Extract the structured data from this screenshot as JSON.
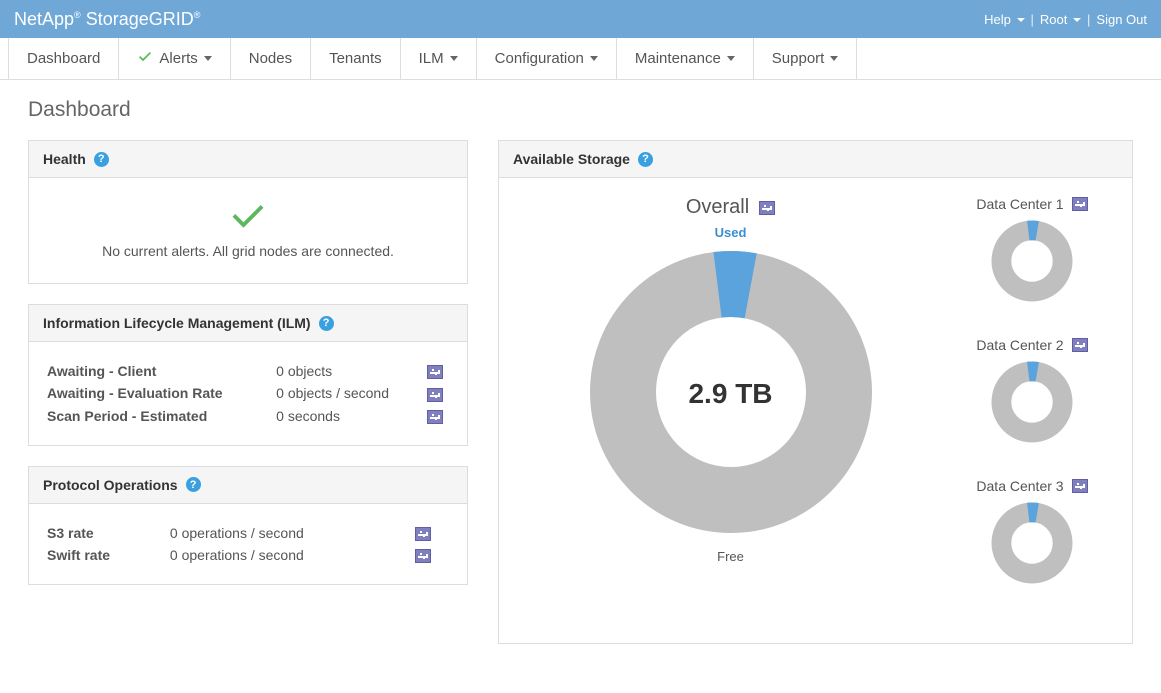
{
  "brand": {
    "text": "NetApp® StorageGRID®",
    "plain1": "NetApp",
    "reg": "®",
    "plain2": " StorageGRID",
    "reg2": "®"
  },
  "topRight": {
    "help": "Help",
    "user": "Root",
    "signOut": "Sign Out"
  },
  "nav": {
    "dashboard": "Dashboard",
    "alerts": "Alerts",
    "nodes": "Nodes",
    "tenants": "Tenants",
    "ilm": "ILM",
    "configuration": "Configuration",
    "maintenance": "Maintenance",
    "support": "Support"
  },
  "pageTitle": "Dashboard",
  "health": {
    "title": "Health",
    "message": "No current alerts. All grid nodes are connected."
  },
  "ilm": {
    "title": "Information Lifecycle Management (ILM)",
    "rows": [
      {
        "label": "Awaiting - Client",
        "value": "0 objects"
      },
      {
        "label": "Awaiting - Evaluation Rate",
        "value": "0 objects / second"
      },
      {
        "label": "Scan Period - Estimated",
        "value": "0 seconds"
      }
    ]
  },
  "protocol": {
    "title": "Protocol Operations",
    "rows": [
      {
        "label": "S3 rate",
        "value": "0 operations / second"
      },
      {
        "label": "Swift rate",
        "value": "0 operations / second"
      }
    ]
  },
  "storage": {
    "title": "Available Storage",
    "overallLabel": "Overall",
    "usedLabel": "Used",
    "freeLabel": "Free",
    "total": "2.9 TB",
    "sites": [
      {
        "name": "Data Center 1"
      },
      {
        "name": "Data Center 2"
      },
      {
        "name": "Data Center 3"
      }
    ]
  },
  "chart_data": [
    {
      "type": "pie",
      "title": "Overall Available Storage",
      "series": [
        {
          "name": "Used",
          "value": 5
        },
        {
          "name": "Free",
          "value": 95
        }
      ],
      "total_label": "2.9 TB",
      "colors": {
        "Used": "#5ba3dc",
        "Free": "#bfbfbf"
      }
    },
    {
      "type": "pie",
      "title": "Data Center 1",
      "series": [
        {
          "name": "Used",
          "value": 5
        },
        {
          "name": "Free",
          "value": 95
        }
      ]
    },
    {
      "type": "pie",
      "title": "Data Center 2",
      "series": [
        {
          "name": "Used",
          "value": 5
        },
        {
          "name": "Free",
          "value": 95
        }
      ]
    },
    {
      "type": "pie",
      "title": "Data Center 3",
      "series": [
        {
          "name": "Used",
          "value": 5
        },
        {
          "name": "Free",
          "value": 95
        }
      ]
    }
  ]
}
